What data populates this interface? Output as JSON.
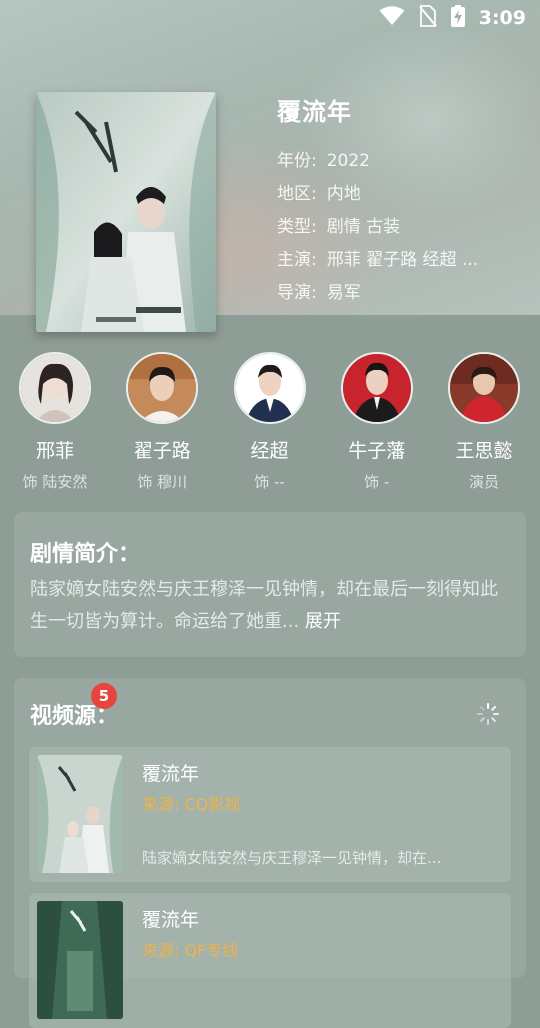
{
  "status_bar": {
    "time": "3:09"
  },
  "movie": {
    "title": "覆流年",
    "fields": [
      {
        "label": "年份:",
        "value": "2022"
      },
      {
        "label": "地区:",
        "value": "内地"
      },
      {
        "label": "类型:",
        "value": "剧情 古装"
      },
      {
        "label": "主演:",
        "value": "邢菲 翟子路 经超 ..."
      },
      {
        "label": "导演:",
        "value": "易军"
      }
    ]
  },
  "cast": [
    {
      "name": "邢菲",
      "role": "饰 陆安然"
    },
    {
      "name": "翟子路",
      "role": "饰 穆川"
    },
    {
      "name": "经超",
      "role": "饰 --"
    },
    {
      "name": "牛子藩",
      "role": "饰 -"
    },
    {
      "name": "王思懿",
      "role": "演员"
    }
  ],
  "synopsis": {
    "title": "剧情简介：",
    "text": "陆家嫡女陆安然与庆王穆泽一见钟情，却在最后一刻得知此生一切皆为算计。命运给了她重...",
    "expand_label": "展开"
  },
  "sources": {
    "title": "视频源：",
    "badge": "5",
    "items": [
      {
        "title": "覆流年",
        "origin": "来源: CQ影视",
        "desc": "陆家嫡女陆安然与庆王穆泽一见钟情，却在..."
      },
      {
        "title": "覆流年",
        "origin": "来源: QF专线",
        "desc": ""
      }
    ]
  },
  "colors": {
    "badge": "#e5453b",
    "source_origin": "#efb34a",
    "background": "#8e9d96"
  }
}
